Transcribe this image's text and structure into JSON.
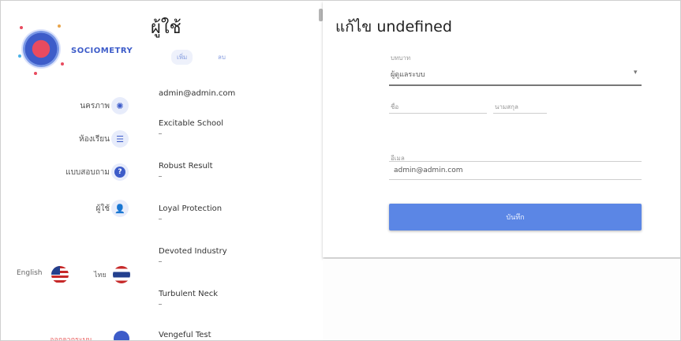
{
  "nav": {
    "brand": "SOCIOMETRY",
    "items": [
      {
        "label": "นครภาพ",
        "icon": "sun-icon"
      },
      {
        "label": "ห้องเรียน",
        "icon": "classroom-icon"
      },
      {
        "label": "แบบสอบถาม",
        "icon": "help-icon"
      },
      {
        "label": "ผู้ใช้",
        "icon": "user-icon"
      }
    ],
    "languages": [
      {
        "label": "English",
        "icon": "us-flag-icon"
      },
      {
        "label": "ไทย",
        "icon": "thai-flag-icon"
      }
    ],
    "logout": "ออกจากระบบ"
  },
  "list": {
    "title": "ผู้ใช้",
    "tabs": [
      {
        "label": "เพิ่ม",
        "active": true
      },
      {
        "label": "ลบ",
        "active": false
      }
    ],
    "rows": [
      {
        "title": "admin@admin.com"
      },
      {
        "title": "Excitable School"
      },
      {
        "title": "Robust Result"
      },
      {
        "title": "Loyal Protection"
      },
      {
        "title": "Devoted Industry"
      },
      {
        "title": "Turbulent Neck"
      },
      {
        "title": "Vengeful Test"
      }
    ]
  },
  "edit": {
    "title": "แก้ไข undefined",
    "role_label": "บทบาท",
    "role_value": "ผู้ดูแลระบบ",
    "firstname_label": "ชื่อ",
    "lastname_label": "นามสกุล",
    "email_label": "อีเมล",
    "email_value": "admin@admin.com",
    "submit": "บันทึก"
  },
  "colors": {
    "accent": "#3d5cc9",
    "button": "#5b86e5",
    "logout": "#e85a5a"
  }
}
